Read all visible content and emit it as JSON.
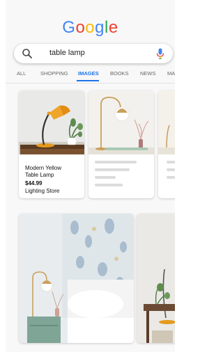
{
  "logo": {
    "letters": [
      {
        "char": "G",
        "color": "#4285F4"
      },
      {
        "char": "o",
        "color": "#EA4335"
      },
      {
        "char": "o",
        "color": "#FBBC05"
      },
      {
        "char": "g",
        "color": "#4285F4"
      },
      {
        "char": "l",
        "color": "#34A853"
      },
      {
        "char": "e",
        "color": "#EA4335"
      }
    ]
  },
  "search": {
    "query": "table lamp",
    "icon": "search-icon",
    "mic_icon": "microphone-icon"
  },
  "tabs": [
    {
      "label": "ALL",
      "active": false
    },
    {
      "label": "SHOPPING",
      "active": false
    },
    {
      "label": "IMAGES",
      "active": true
    },
    {
      "label": "BOOKS",
      "active": false
    },
    {
      "label": "NEWS",
      "active": false
    },
    {
      "label": "MA",
      "active": false
    }
  ],
  "colors": {
    "accent": "#1a73e8",
    "placeholder_bar": "#dcdcdc"
  },
  "product": {
    "title": "Modern Yellow Table Lamp",
    "title_line1": "Modern Yellow",
    "title_line2": "Table Lamp",
    "price": "$44.99",
    "store": "Lighting Store"
  }
}
